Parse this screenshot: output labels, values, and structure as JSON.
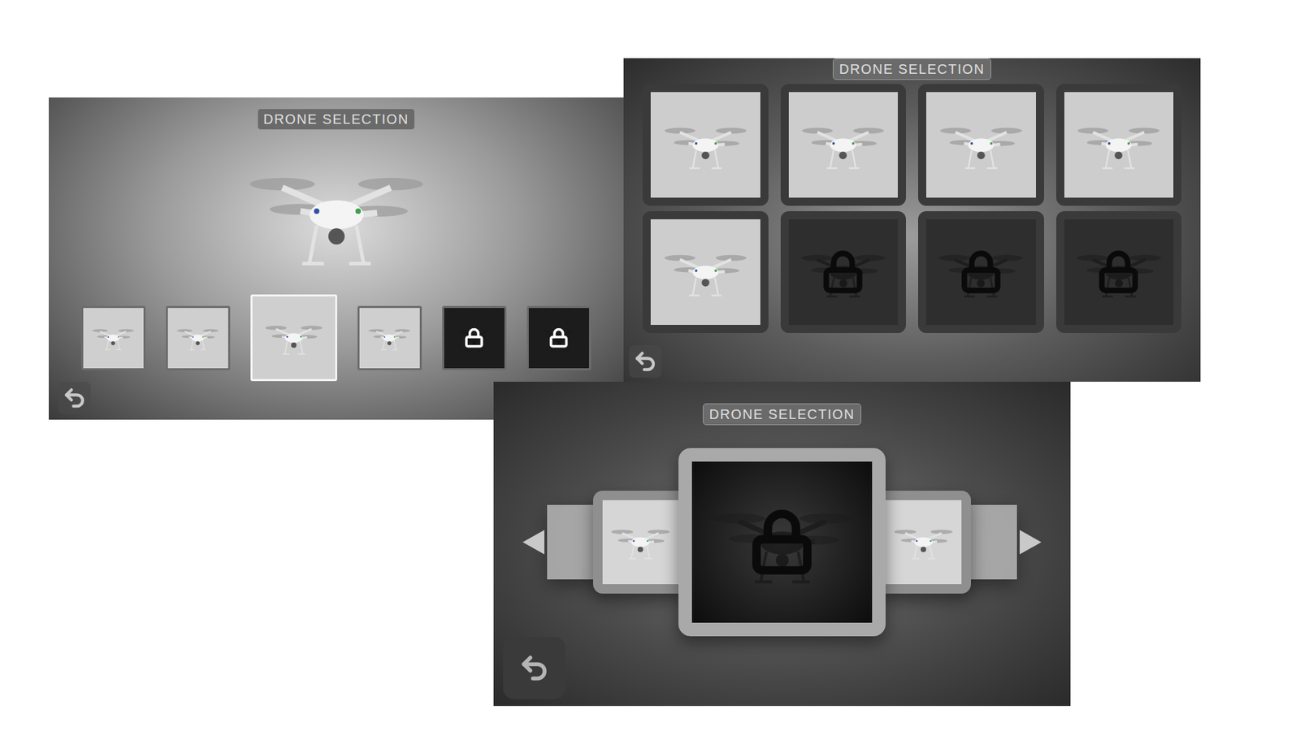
{
  "screens": [
    {
      "kind": "strip",
      "title": "DRONE SELECTION",
      "drones": [
        {
          "locked": false,
          "selected": false
        },
        {
          "locked": false,
          "selected": false
        },
        {
          "locked": false,
          "selected": true
        },
        {
          "locked": false,
          "selected": false
        },
        {
          "locked": true,
          "selected": false
        },
        {
          "locked": true,
          "selected": false
        }
      ]
    },
    {
      "kind": "grid",
      "title": "DRONE SELECTION",
      "drones": [
        {
          "locked": false,
          "selected": false
        },
        {
          "locked": false,
          "selected": false
        },
        {
          "locked": false,
          "selected": false
        },
        {
          "locked": false,
          "selected": false
        },
        {
          "locked": false,
          "selected": false
        },
        {
          "locked": true,
          "selected": false
        },
        {
          "locked": true,
          "selected": false
        },
        {
          "locked": true,
          "selected": false
        }
      ]
    },
    {
      "kind": "carousel",
      "title": "DRONE SELECTION",
      "drones": [
        {
          "locked": false,
          "selected": false
        },
        {
          "locked": false,
          "selected": false
        },
        {
          "locked": true,
          "selected": true
        },
        {
          "locked": false,
          "selected": false
        },
        {
          "locked": false,
          "selected": false
        }
      ]
    }
  ]
}
